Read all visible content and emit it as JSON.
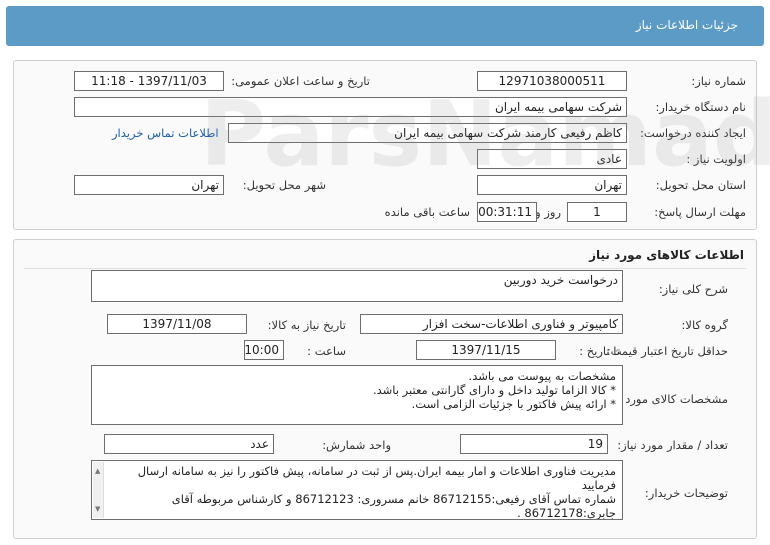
{
  "header": {
    "title": "جزئیات اطلاعات نیاز"
  },
  "info": {
    "need_number_label": "شماره نیاز:",
    "need_number": "12971038000511",
    "announce_label": "تاریخ و ساعت اعلان عمومی:",
    "announce_value": "1397/11/03 - 11:18",
    "buyer_label": "نام دستگاه خریدار:",
    "buyer_value": "شرکت سهامی بیمه ایران",
    "creator_label": "ایجاد کننده درخواست:",
    "creator_value": "کاظم رفیعی کارمند شرکت سهامی بیمه ایران",
    "contact_link": "اطلاعات تماس خریدار",
    "priority_label": "اولویت نیاز :",
    "priority_value": "عادی",
    "province_label": "استان محل تحویل:",
    "province_value": "تهران",
    "city_label": "شهر محل تحویل:",
    "city_value": "تهران",
    "deadline_label": "مهلت ارسال پاسخ:",
    "days_value": "1",
    "days_unit": "روز و",
    "time_value": "00:31:11",
    "time_unit": "ساعت باقی مانده"
  },
  "goods": {
    "section_title": "اطلاعات کالاهای مورد نیاز",
    "summary_label": "شرح کلی نیاز:",
    "summary_value": "درخواست خرید دوربین",
    "group_label": "گروه کالا:",
    "group_value": "کامپیوتر و فناوری اطلاعات-سخت افزار",
    "need_date_label": "تاریخ نیاز به کالا:",
    "need_date_value": "1397/11/08",
    "min_validity_label": "حداقل تاریخ اعتبار قیمت:",
    "to_date_label": "تا تاریخ :",
    "to_date_value": "1397/11/15",
    "hour_label": "ساعت :",
    "hour_value": "10:00",
    "specs_label": "مشخصات کالای مورد نیاز:",
    "specs_lines": [
      "مشخصات به پیوست می باشد.",
      "* کالا الزاما تولید داخل و دارای گارانتی معتبر باشد.",
      "* ارائه پیش فاکتور با جزئیات الزامی است."
    ],
    "qty_label": "تعداد / مقدار مورد نیاز:",
    "qty_value": "19",
    "unit_label": "واحد شمارش:",
    "unit_value": "عدد",
    "desc_label": "توضیحات خریدار:",
    "desc_lines": [
      "مدیریت فناوری اطلاعات و امار بیمه ایران.پس از ثبت در سامانه، پیش فاکتور را نیز به سامانه ارسال فرمایید",
      "شماره تماس آقای رفیعی:86712155 خانم مسروری: 86712123 و کارشناس مربوطه آقای جابری:86712178 ."
    ]
  },
  "watermark": "ParsNamadha"
}
